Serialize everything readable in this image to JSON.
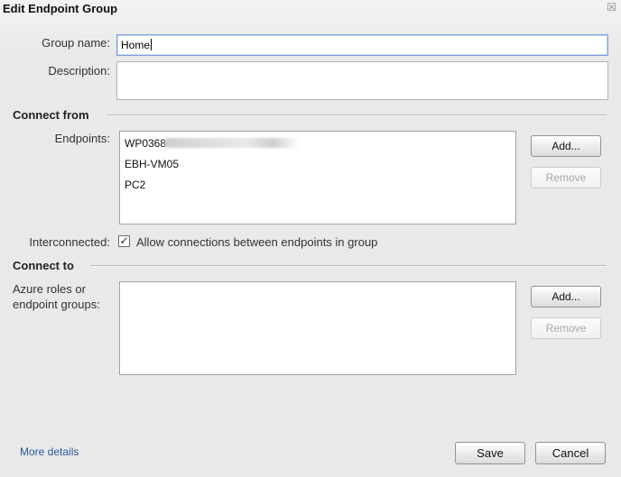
{
  "window": {
    "title": "Edit Endpoint Group",
    "close_glyph": "☒"
  },
  "form": {
    "group_name_label": "Group name:",
    "group_name_value": "Home",
    "description_label": "Description:",
    "description_value": ""
  },
  "connect_from": {
    "heading": "Connect from",
    "endpoints_label": "Endpoints:",
    "endpoints": [
      "WP0368",
      "EBH-VM05",
      "PC2"
    ],
    "add_label": "Add...",
    "remove_label": "Remove",
    "interconnected_label": "Interconnected:",
    "interconnected_checked": true,
    "check_glyph": "✓",
    "interconnected_text": "Allow connections between endpoints in group"
  },
  "connect_to": {
    "heading": "Connect to",
    "label_line1": "Azure roles or",
    "label_line2": "endpoint groups:",
    "items": [],
    "add_label": "Add...",
    "remove_label": "Remove"
  },
  "footer": {
    "more_details": "More details",
    "save_label": "Save",
    "cancel_label": "Cancel"
  },
  "colors": {
    "link": "#2d5a9e",
    "focus_border": "#7aa3d6",
    "background": "#ebebeb"
  },
  "icons": {
    "close": "close-icon",
    "check": "checkmark-icon"
  }
}
